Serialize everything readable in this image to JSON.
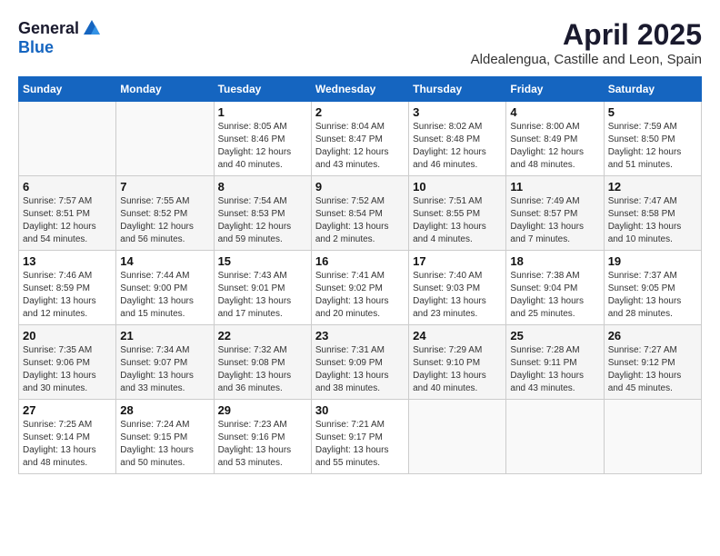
{
  "header": {
    "logo_general": "General",
    "logo_blue": "Blue",
    "title": "April 2025",
    "location": "Aldealengua, Castille and Leon, Spain"
  },
  "weekdays": [
    "Sunday",
    "Monday",
    "Tuesday",
    "Wednesday",
    "Thursday",
    "Friday",
    "Saturday"
  ],
  "weeks": [
    [
      {
        "day": "",
        "detail": ""
      },
      {
        "day": "",
        "detail": ""
      },
      {
        "day": "1",
        "detail": "Sunrise: 8:05 AM\nSunset: 8:46 PM\nDaylight: 12 hours and 40 minutes."
      },
      {
        "day": "2",
        "detail": "Sunrise: 8:04 AM\nSunset: 8:47 PM\nDaylight: 12 hours and 43 minutes."
      },
      {
        "day": "3",
        "detail": "Sunrise: 8:02 AM\nSunset: 8:48 PM\nDaylight: 12 hours and 46 minutes."
      },
      {
        "day": "4",
        "detail": "Sunrise: 8:00 AM\nSunset: 8:49 PM\nDaylight: 12 hours and 48 minutes."
      },
      {
        "day": "5",
        "detail": "Sunrise: 7:59 AM\nSunset: 8:50 PM\nDaylight: 12 hours and 51 minutes."
      }
    ],
    [
      {
        "day": "6",
        "detail": "Sunrise: 7:57 AM\nSunset: 8:51 PM\nDaylight: 12 hours and 54 minutes."
      },
      {
        "day": "7",
        "detail": "Sunrise: 7:55 AM\nSunset: 8:52 PM\nDaylight: 12 hours and 56 minutes."
      },
      {
        "day": "8",
        "detail": "Sunrise: 7:54 AM\nSunset: 8:53 PM\nDaylight: 12 hours and 59 minutes."
      },
      {
        "day": "9",
        "detail": "Sunrise: 7:52 AM\nSunset: 8:54 PM\nDaylight: 13 hours and 2 minutes."
      },
      {
        "day": "10",
        "detail": "Sunrise: 7:51 AM\nSunset: 8:55 PM\nDaylight: 13 hours and 4 minutes."
      },
      {
        "day": "11",
        "detail": "Sunrise: 7:49 AM\nSunset: 8:57 PM\nDaylight: 13 hours and 7 minutes."
      },
      {
        "day": "12",
        "detail": "Sunrise: 7:47 AM\nSunset: 8:58 PM\nDaylight: 13 hours and 10 minutes."
      }
    ],
    [
      {
        "day": "13",
        "detail": "Sunrise: 7:46 AM\nSunset: 8:59 PM\nDaylight: 13 hours and 12 minutes."
      },
      {
        "day": "14",
        "detail": "Sunrise: 7:44 AM\nSunset: 9:00 PM\nDaylight: 13 hours and 15 minutes."
      },
      {
        "day": "15",
        "detail": "Sunrise: 7:43 AM\nSunset: 9:01 PM\nDaylight: 13 hours and 17 minutes."
      },
      {
        "day": "16",
        "detail": "Sunrise: 7:41 AM\nSunset: 9:02 PM\nDaylight: 13 hours and 20 minutes."
      },
      {
        "day": "17",
        "detail": "Sunrise: 7:40 AM\nSunset: 9:03 PM\nDaylight: 13 hours and 23 minutes."
      },
      {
        "day": "18",
        "detail": "Sunrise: 7:38 AM\nSunset: 9:04 PM\nDaylight: 13 hours and 25 minutes."
      },
      {
        "day": "19",
        "detail": "Sunrise: 7:37 AM\nSunset: 9:05 PM\nDaylight: 13 hours and 28 minutes."
      }
    ],
    [
      {
        "day": "20",
        "detail": "Sunrise: 7:35 AM\nSunset: 9:06 PM\nDaylight: 13 hours and 30 minutes."
      },
      {
        "day": "21",
        "detail": "Sunrise: 7:34 AM\nSunset: 9:07 PM\nDaylight: 13 hours and 33 minutes."
      },
      {
        "day": "22",
        "detail": "Sunrise: 7:32 AM\nSunset: 9:08 PM\nDaylight: 13 hours and 36 minutes."
      },
      {
        "day": "23",
        "detail": "Sunrise: 7:31 AM\nSunset: 9:09 PM\nDaylight: 13 hours and 38 minutes."
      },
      {
        "day": "24",
        "detail": "Sunrise: 7:29 AM\nSunset: 9:10 PM\nDaylight: 13 hours and 40 minutes."
      },
      {
        "day": "25",
        "detail": "Sunrise: 7:28 AM\nSunset: 9:11 PM\nDaylight: 13 hours and 43 minutes."
      },
      {
        "day": "26",
        "detail": "Sunrise: 7:27 AM\nSunset: 9:12 PM\nDaylight: 13 hours and 45 minutes."
      }
    ],
    [
      {
        "day": "27",
        "detail": "Sunrise: 7:25 AM\nSunset: 9:14 PM\nDaylight: 13 hours and 48 minutes."
      },
      {
        "day": "28",
        "detail": "Sunrise: 7:24 AM\nSunset: 9:15 PM\nDaylight: 13 hours and 50 minutes."
      },
      {
        "day": "29",
        "detail": "Sunrise: 7:23 AM\nSunset: 9:16 PM\nDaylight: 13 hours and 53 minutes."
      },
      {
        "day": "30",
        "detail": "Sunrise: 7:21 AM\nSunset: 9:17 PM\nDaylight: 13 hours and 55 minutes."
      },
      {
        "day": "",
        "detail": ""
      },
      {
        "day": "",
        "detail": ""
      },
      {
        "day": "",
        "detail": ""
      }
    ]
  ]
}
